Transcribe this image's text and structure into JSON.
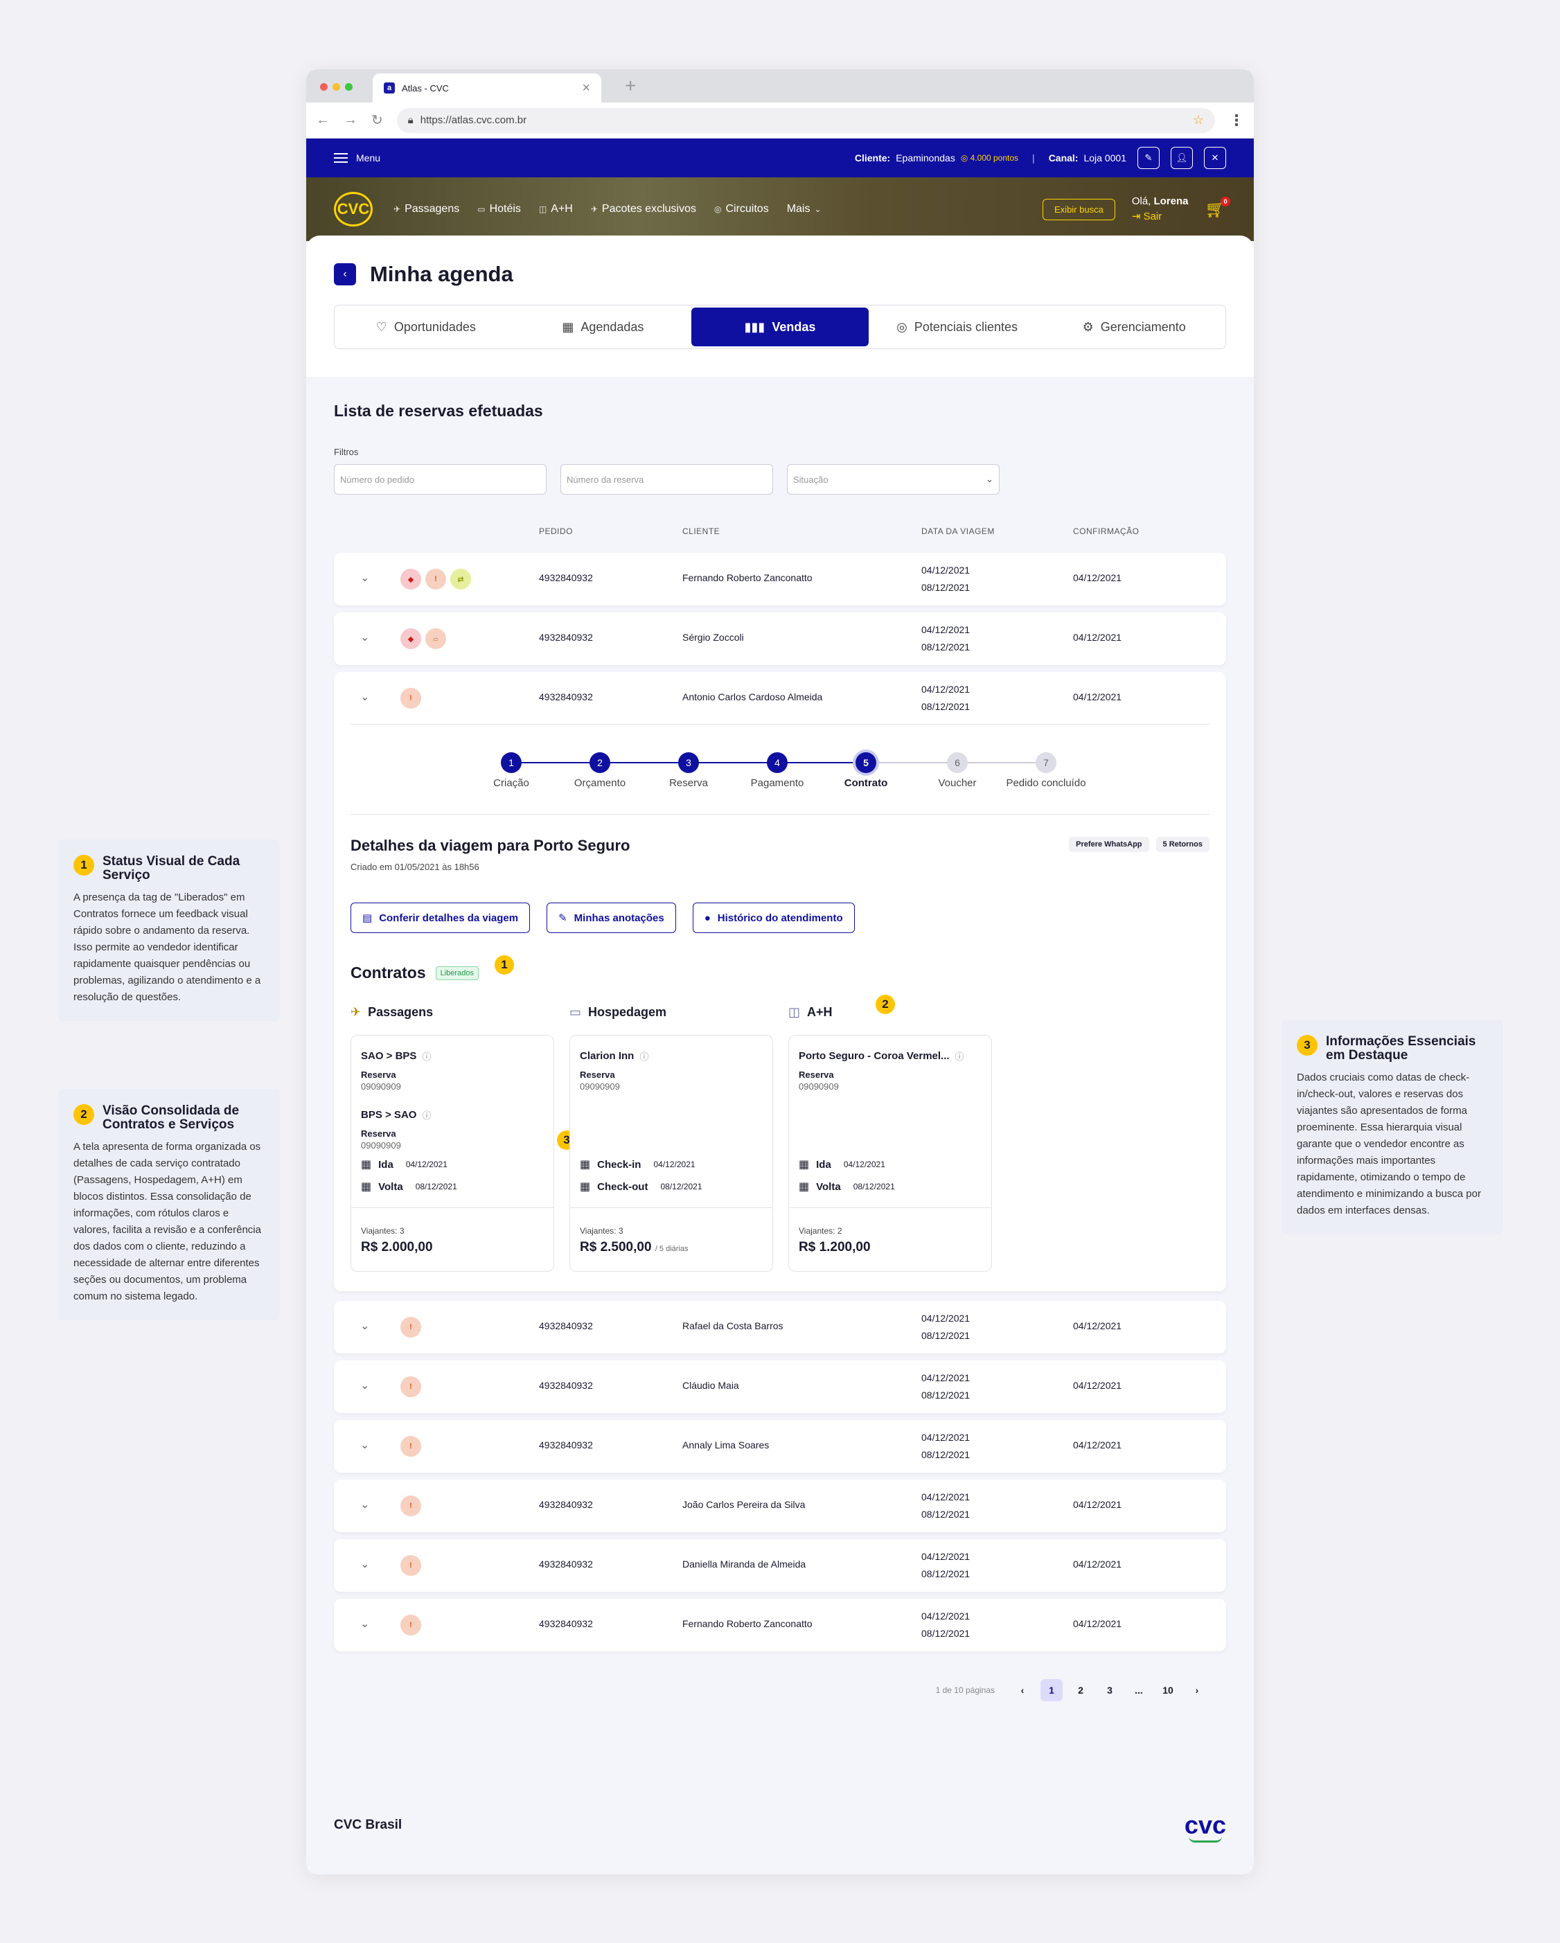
{
  "browser": {
    "tab_title": "Atlas - CVC",
    "favicon": "a",
    "url": "https://atlas.cvc.com.br"
  },
  "topbar": {
    "menu_label": "Menu",
    "cliente_label": "Cliente:",
    "cliente_name": "Epaminondas",
    "points": "4.000 pontos",
    "canal_label": "Canal:",
    "canal_value": "Loja 0001"
  },
  "header": {
    "logo": "CVC",
    "nav": [
      "Passagens",
      "Hotéis",
      "A+H",
      "Pacotes exclusivos",
      "Circuitos",
      "Mais"
    ],
    "exibir_busca": "Exibir busca",
    "hello_prefix": "Olá,",
    "user": "Lorena",
    "logout": "Sair",
    "cart_count": "0"
  },
  "page": {
    "title": "Minha agenda",
    "tabs": [
      "Oportunidades",
      "Agendadas",
      "Vendas",
      "Potenciais clientes",
      "Gerenciamento"
    ],
    "active_tab": "Vendas"
  },
  "list": {
    "title": "Lista de reservas efetuadas",
    "filters_label": "Filtros",
    "filters": [
      "Número do pedido",
      "Número da reserva",
      "Situação"
    ],
    "columns": [
      "PEDIDO",
      "CLIENTE",
      "DATA DA VIAGEM",
      "CONFIRMAÇÃO"
    ],
    "rows": [
      {
        "pedido": "4932840932",
        "cliente": "Fernando Roberto Zanconatto",
        "ida": "04/12/2021",
        "volta": "08/12/2021",
        "conf": "04/12/2021"
      },
      {
        "pedido": "4932840932",
        "cliente": "Sérgio Zoccoli",
        "ida": "04/12/2021",
        "volta": "08/12/2021",
        "conf": "04/12/2021"
      },
      {
        "pedido": "4932840932",
        "cliente": "Antonio Carlos Cardoso Almeida",
        "ida": "04/12/2021",
        "volta": "08/12/2021",
        "conf": "04/12/2021"
      },
      {
        "pedido": "4932840932",
        "cliente": "Rafael da Costa Barros",
        "ida": "04/12/2021",
        "volta": "08/12/2021",
        "conf": "04/12/2021"
      },
      {
        "pedido": "4932840932",
        "cliente": "Cláudio Maia",
        "ida": "04/12/2021",
        "volta": "08/12/2021",
        "conf": "04/12/2021"
      },
      {
        "pedido": "4932840932",
        "cliente": "Annaly Lima Soares",
        "ida": "04/12/2021",
        "volta": "08/12/2021",
        "conf": "04/12/2021"
      },
      {
        "pedido": "4932840932",
        "cliente": "João Carlos Pereira da Silva",
        "ida": "04/12/2021",
        "volta": "08/12/2021",
        "conf": "04/12/2021"
      },
      {
        "pedido": "4932840932",
        "cliente": "Daniella Miranda de Almeida",
        "ida": "04/12/2021",
        "volta": "08/12/2021",
        "conf": "04/12/2021"
      },
      {
        "pedido": "4932840932",
        "cliente": "Fernando Roberto Zanconatto",
        "ida": "04/12/2021",
        "volta": "08/12/2021",
        "conf": "04/12/2021"
      }
    ]
  },
  "steps": [
    {
      "n": "1",
      "label": "Criação"
    },
    {
      "n": "2",
      "label": "Orçamento"
    },
    {
      "n": "3",
      "label": "Reserva"
    },
    {
      "n": "4",
      "label": "Pagamento"
    },
    {
      "n": "5",
      "label": "Contrato"
    },
    {
      "n": "6",
      "label": "Voucher"
    },
    {
      "n": "7",
      "label": "Pedido concluído"
    }
  ],
  "details": {
    "title": "Detalhes da viagem para Porto Seguro",
    "created": "Criado em 01/05/2021 às 18h56",
    "chips": [
      "Prefere WhatsApp",
      "5 Retornos"
    ],
    "buttons": [
      "Conferir detalhes da viagem",
      "Minhas anotações",
      "Histórico do atendimento"
    ],
    "contracts_title": "Contratos",
    "contracts_badge": "Liberados"
  },
  "services": [
    {
      "name": "Passagens",
      "items": [
        {
          "t": "SAO > BPS",
          "l": "Reserva",
          "c": "09090909"
        },
        {
          "t": "BPS > SAO",
          "l": "Reserva",
          "c": "09090909"
        }
      ],
      "d1l": "Ida",
      "d1": "04/12/2021",
      "d2l": "Volta",
      "d2": "08/12/2021",
      "viaj": "Viajantes: 3",
      "price": "R$ 2.000,00",
      "extra": ""
    },
    {
      "name": "Hospedagem",
      "items": [
        {
          "t": "Clarion Inn",
          "l": "Reserva",
          "c": "09090909"
        }
      ],
      "d1l": "Check-in",
      "d1": "04/12/2021",
      "d2l": "Check-out",
      "d2": "08/12/2021",
      "viaj": "Viajantes: 3",
      "price": "R$ 2.500,00",
      "extra": "/ 5 diárias"
    },
    {
      "name": "A+H",
      "items": [
        {
          "t": "Porto Seguro - Coroa Vermel...",
          "l": "Reserva",
          "c": "09090909"
        }
      ],
      "d1l": "Ida",
      "d1": "04/12/2021",
      "d2l": "Volta",
      "d2": "08/12/2021",
      "viaj": "Viajantes: 2",
      "price": "R$ 1.200,00",
      "extra": ""
    }
  ],
  "pagination": {
    "info": "1 de 10 páginas",
    "pages": [
      "1",
      "2",
      "3",
      "...",
      "10"
    ]
  },
  "footer": {
    "text": "CVC Brasil",
    "logo": "cvc"
  },
  "notes": [
    {
      "n": "1",
      "title": "Status Visual de Cada Serviço",
      "body": "A presença da tag de \"Liberados\" em Contratos fornece um feedback visual rápido sobre o andamento da reserva. Isso permite ao vendedor identificar rapidamente quaisquer pendências ou problemas, agilizando o atendimento e a resolução de questões."
    },
    {
      "n": "2",
      "title": "Visão Consolidada de Contratos e Serviços",
      "body": "A tela apresenta de forma organizada os detalhes de cada serviço contratado (Passagens, Hospedagem, A+H) em blocos distintos. Essa consolidação de informações, com rótulos claros e valores, facilita a revisão e a conferência dos dados com o cliente, reduzindo a necessidade de alternar entre diferentes seções ou documentos, um problema comum no sistema legado."
    },
    {
      "n": "3",
      "title": "Informações Essenciais em Destaque",
      "body": "Dados cruciais como datas de check-in/check-out, valores e reservas dos viajantes são apresentados de forma proeminente. Essa hierarquia visual garante que o vendedor encontre as informações mais importantes rapidamente, otimizando o tempo de atendimento e minimizando a busca por dados em interfaces densas."
    }
  ],
  "colors": {
    "primary": "#1010a0",
    "accent": "#ffd400",
    "annotation": "#ffc400"
  }
}
